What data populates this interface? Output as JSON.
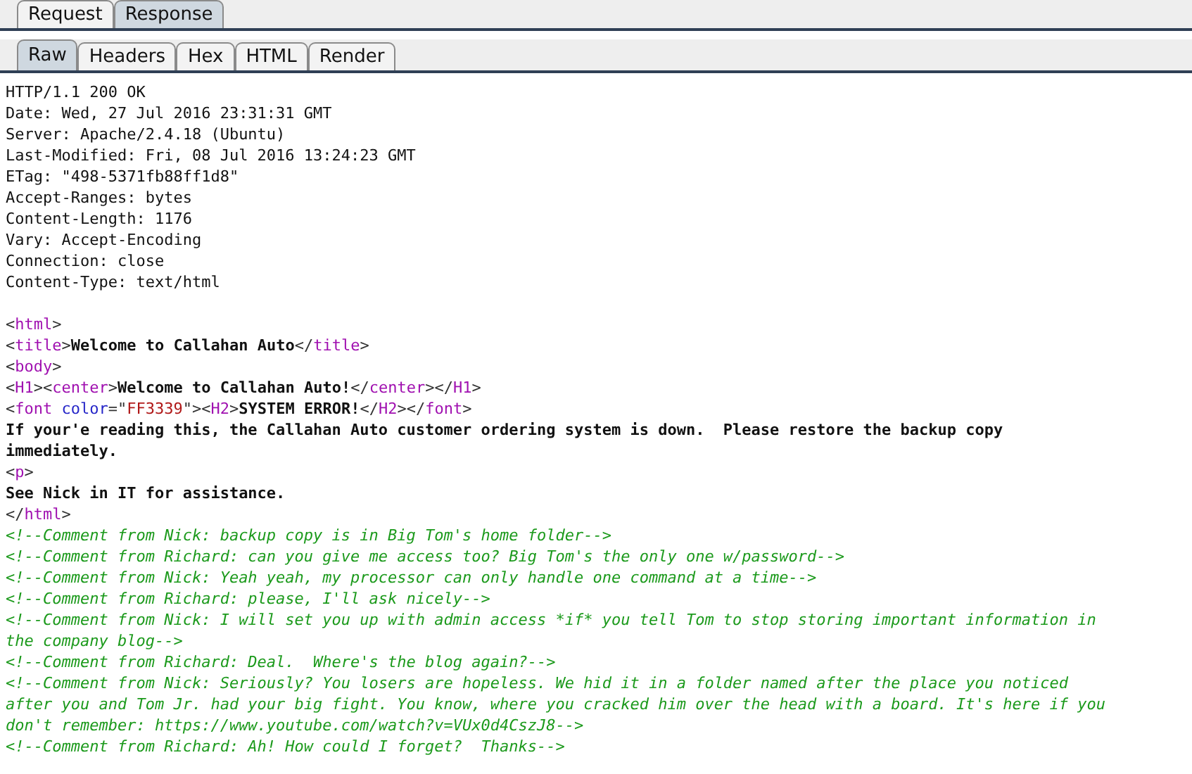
{
  "main_tabs": [
    {
      "label": "Request",
      "selected": false
    },
    {
      "label": "Response",
      "selected": true
    }
  ],
  "view_tabs": [
    {
      "label": "Raw",
      "selected": true
    },
    {
      "label": "Headers",
      "selected": false
    },
    {
      "label": "Hex",
      "selected": false
    },
    {
      "label": "HTML",
      "selected": false
    },
    {
      "label": "Render",
      "selected": false
    }
  ],
  "lines": [
    {
      "kind": "code",
      "parts": [
        {
          "kind": "plain",
          "text": "HTTP/1.1 200 OK"
        }
      ]
    },
    {
      "kind": "code",
      "parts": [
        {
          "kind": "plain",
          "text": "Date: Wed, 27 Jul 2016 23:31:31 GMT"
        }
      ]
    },
    {
      "kind": "code",
      "parts": [
        {
          "kind": "plain",
          "text": "Server: Apache/2.4.18 (Ubuntu)"
        }
      ]
    },
    {
      "kind": "code",
      "parts": [
        {
          "kind": "plain",
          "text": "Last-Modified: Fri, 08 Jul 2016 13:24:23 GMT"
        }
      ]
    },
    {
      "kind": "code",
      "parts": [
        {
          "kind": "plain",
          "text": "ETag: \"498-5371fb88ff1d8\""
        }
      ]
    },
    {
      "kind": "code",
      "parts": [
        {
          "kind": "plain",
          "text": "Accept-Ranges: bytes"
        }
      ]
    },
    {
      "kind": "code",
      "parts": [
        {
          "kind": "plain",
          "text": "Content-Length: 1176"
        }
      ]
    },
    {
      "kind": "code",
      "parts": [
        {
          "kind": "plain",
          "text": "Vary: Accept-Encoding"
        }
      ]
    },
    {
      "kind": "code",
      "parts": [
        {
          "kind": "plain",
          "text": "Connection: close"
        }
      ]
    },
    {
      "kind": "code",
      "parts": [
        {
          "kind": "plain",
          "text": "Content-Type: text/html"
        }
      ]
    },
    {
      "kind": "blank"
    },
    {
      "kind": "code",
      "parts": [
        {
          "kind": "punct",
          "text": "<"
        },
        {
          "kind": "tag",
          "text": "html"
        },
        {
          "kind": "punct",
          "text": ">"
        }
      ]
    },
    {
      "kind": "code",
      "parts": [
        {
          "kind": "punct",
          "text": "<"
        },
        {
          "kind": "tag",
          "text": "title"
        },
        {
          "kind": "punct",
          "text": ">"
        },
        {
          "kind": "bold",
          "text": "Welcome to Callahan Auto"
        },
        {
          "kind": "punct",
          "text": "</"
        },
        {
          "kind": "tag",
          "text": "title"
        },
        {
          "kind": "punct",
          "text": ">"
        }
      ]
    },
    {
      "kind": "code",
      "parts": [
        {
          "kind": "punct",
          "text": "<"
        },
        {
          "kind": "tag",
          "text": "body"
        },
        {
          "kind": "punct",
          "text": ">"
        }
      ]
    },
    {
      "kind": "code",
      "parts": [
        {
          "kind": "punct",
          "text": "<"
        },
        {
          "kind": "tag",
          "text": "H1"
        },
        {
          "kind": "punct",
          "text": "><"
        },
        {
          "kind": "tag",
          "text": "center"
        },
        {
          "kind": "punct",
          "text": ">"
        },
        {
          "kind": "bold",
          "text": "Welcome to Callahan Auto!"
        },
        {
          "kind": "punct",
          "text": "</"
        },
        {
          "kind": "tag",
          "text": "center"
        },
        {
          "kind": "punct",
          "text": "></"
        },
        {
          "kind": "tag",
          "text": "H1"
        },
        {
          "kind": "punct",
          "text": ">"
        }
      ]
    },
    {
      "kind": "code",
      "parts": [
        {
          "kind": "punct",
          "text": "<"
        },
        {
          "kind": "tag",
          "text": "font"
        },
        {
          "kind": "attr",
          "text": " color"
        },
        {
          "kind": "punct",
          "text": "=\""
        },
        {
          "kind": "value",
          "text": "FF3339"
        },
        {
          "kind": "punct",
          "text": "\"><"
        },
        {
          "kind": "tag",
          "text": "H2"
        },
        {
          "kind": "punct",
          "text": ">"
        },
        {
          "kind": "bold",
          "text": "SYSTEM ERROR!"
        },
        {
          "kind": "punct",
          "text": "</"
        },
        {
          "kind": "tag",
          "text": "H2"
        },
        {
          "kind": "punct",
          "text": "></"
        },
        {
          "kind": "tag",
          "text": "font"
        },
        {
          "kind": "punct",
          "text": ">"
        }
      ]
    },
    {
      "kind": "code",
      "parts": [
        {
          "kind": "bold",
          "text": "If your'e reading this, the Callahan Auto customer ordering system is down.  Please restore the backup copy"
        }
      ]
    },
    {
      "kind": "code",
      "parts": [
        {
          "kind": "bold",
          "text": "immediately."
        }
      ]
    },
    {
      "kind": "code",
      "parts": [
        {
          "kind": "punct",
          "text": "<"
        },
        {
          "kind": "tag",
          "text": "p"
        },
        {
          "kind": "punct",
          "text": ">"
        }
      ]
    },
    {
      "kind": "code",
      "parts": [
        {
          "kind": "bold",
          "text": "See Nick in IT for assistance."
        }
      ]
    },
    {
      "kind": "code",
      "parts": [
        {
          "kind": "punct",
          "text": "</"
        },
        {
          "kind": "tag",
          "text": "html"
        },
        {
          "kind": "punct",
          "text": ">"
        }
      ]
    },
    {
      "kind": "code",
      "parts": [
        {
          "kind": "comment",
          "text": "<!--Comment from Nick: backup copy is in Big Tom's home folder-->"
        }
      ]
    },
    {
      "kind": "code",
      "parts": [
        {
          "kind": "comment",
          "text": "<!--Comment from Richard: can you give me access too? Big Tom's the only one w/password-->"
        }
      ]
    },
    {
      "kind": "code",
      "parts": [
        {
          "kind": "comment",
          "text": "<!--Comment from Nick: Yeah yeah, my processor can only handle one command at a time-->"
        }
      ]
    },
    {
      "kind": "code",
      "parts": [
        {
          "kind": "comment",
          "text": "<!--Comment from Richard: please, I'll ask nicely-->"
        }
      ]
    },
    {
      "kind": "code",
      "parts": [
        {
          "kind": "comment",
          "text": "<!--Comment from Nick: I will set you up with admin access *if* you tell Tom to stop storing important information in"
        }
      ]
    },
    {
      "kind": "code",
      "parts": [
        {
          "kind": "comment",
          "text": "the company blog-->"
        }
      ]
    },
    {
      "kind": "code",
      "parts": [
        {
          "kind": "comment",
          "text": "<!--Comment from Richard: Deal.  Where's the blog again?-->"
        }
      ]
    },
    {
      "kind": "code",
      "parts": [
        {
          "kind": "comment",
          "text": "<!--Comment from Nick: Seriously? You losers are hopeless. We hid it in a folder named after the place you noticed"
        }
      ]
    },
    {
      "kind": "code",
      "parts": [
        {
          "kind": "comment",
          "text": "after you and Tom Jr. had your big fight. You know, where you cracked him over the head with a board. It's here if you"
        }
      ]
    },
    {
      "kind": "code",
      "parts": [
        {
          "kind": "comment",
          "text": "don't remember: https://www.youtube.com/watch?v=VUx0d4CszJ8-->"
        }
      ]
    },
    {
      "kind": "code",
      "parts": [
        {
          "kind": "comment",
          "text": "<!--Comment from Richard: Ah! How could I forget?  Thanks-->"
        }
      ]
    }
  ]
}
